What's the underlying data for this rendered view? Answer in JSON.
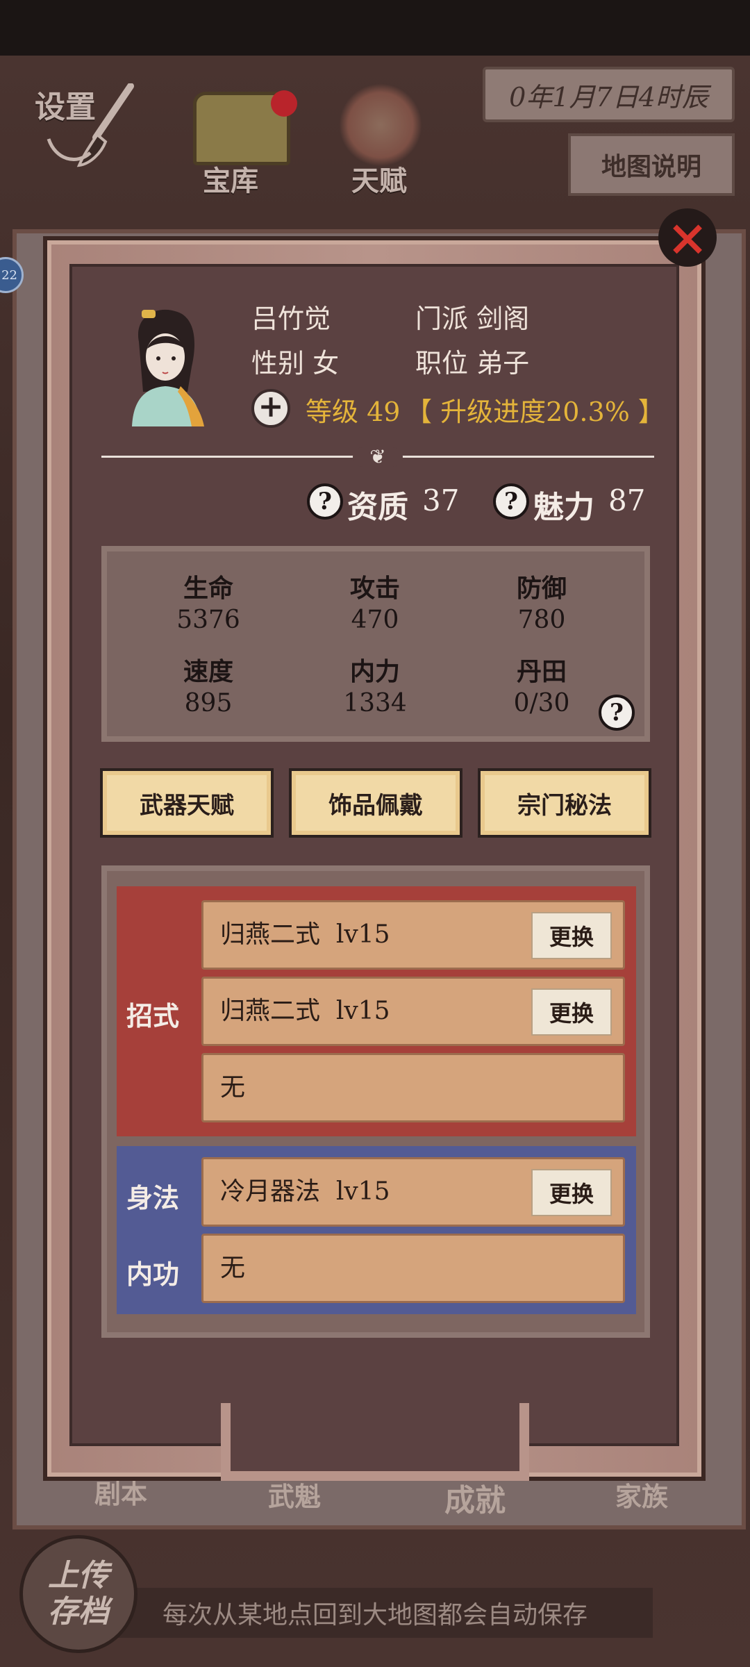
{
  "top_bar": {
    "settings_label": "设置",
    "treasury_label": "宝库",
    "talent_label": "天赋",
    "date_text": "0年1月7日4时辰",
    "map_info_label": "地图说明"
  },
  "side_badge": "22",
  "bottom_nav": {
    "script_label": "剧本",
    "champion_label": "武魁",
    "achievement_label": "成就",
    "clan_label": "家族"
  },
  "upload": {
    "line1": "上传",
    "line2": "存档"
  },
  "autosave_notice": "每次从某地点回到大地图都会自动保存",
  "character": {
    "name": "吕竹觉",
    "sect": "门派 剑阁",
    "gender": "性别 女",
    "position": "职位 弟子",
    "level_text": "等级 49",
    "progress_text": "【 升级进度20.3% 】",
    "aptitude_label": "资质",
    "aptitude_value": "37",
    "charm_label": "魅力",
    "charm_value": "87"
  },
  "stats": [
    {
      "label": "生命",
      "value": "5376"
    },
    {
      "label": "攻击",
      "value": "470"
    },
    {
      "label": "防御",
      "value": "780"
    },
    {
      "label": "速度",
      "value": "895"
    },
    {
      "label": "内力",
      "value": "1334"
    },
    {
      "label": "丹田",
      "value": "0/30"
    }
  ],
  "tabs": [
    "武器天赋",
    "饰品佩戴",
    "宗门秘法"
  ],
  "skills": {
    "moves_label": "招式",
    "movement_label": "身法",
    "inner_label": "内功",
    "swap_label": "更换",
    "move_slots": [
      {
        "name": "归燕二式",
        "level": "lv15"
      },
      {
        "name": "归燕二式",
        "level": "lv15"
      },
      {
        "name": "无",
        "level": ""
      }
    ],
    "movement_slot": {
      "name": "冷月器法",
      "level": "lv15"
    },
    "inner_slot": {
      "name": "无",
      "level": ""
    }
  },
  "colors": {
    "panel_inner": "#5b4141",
    "moves_section": "#a6403a",
    "movement_section": "#535b94",
    "level_gold": "#e4b43a",
    "close_red": "#d8342c"
  },
  "icons": [
    "brush-icon",
    "treasure-chest-icon",
    "flame-buddha-icon",
    "close-icon",
    "plus-icon",
    "help-icon",
    "portrait-icon"
  ]
}
